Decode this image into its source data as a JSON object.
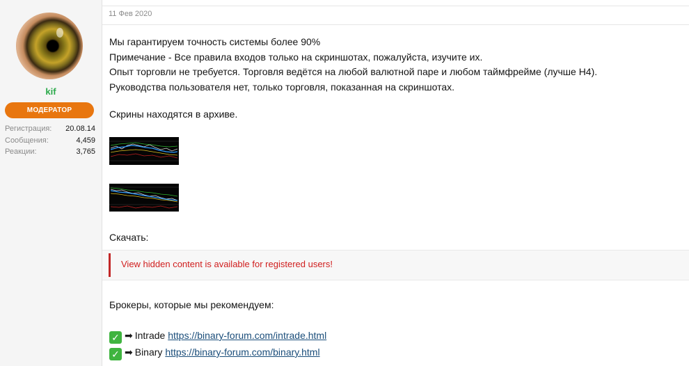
{
  "user": {
    "name": "kif",
    "role": "МОДЕРАТОР",
    "stats": [
      {
        "label": "Регистрация:",
        "value": "20.08.14"
      },
      {
        "label": "Сообщения:",
        "value": "4,459"
      },
      {
        "label": "Реакции:",
        "value": "3,765"
      }
    ]
  },
  "post": {
    "date": "11 Фев 2020",
    "lines": [
      "Мы гарантируем точность системы более 90%",
      "Примечание - Все правила входов только на скриншотах, пожалуйста, изучите их.",
      "Опыт торговли не требуется. Торговля ведётся на любой валютной паре и любом таймфрейме (лучше H4).",
      "Руководства пользователя нет, только торговля, показанная на скриншотах."
    ],
    "archive_text": "Скрины находятся в архиве.",
    "download_label": "Скачать:",
    "hidden_content_text": "View hidden content is available for registered users!",
    "brokers_heading": "Брокеры, которые мы рекомендуем:",
    "brokers": [
      {
        "name": "Intrade",
        "url": "https://binary-forum.com/intrade.html"
      },
      {
        "name": "Binary",
        "url": "https://binary-forum.com/binary.html"
      }
    ]
  },
  "colors": {
    "accent_badge": "#e8760f",
    "username": "#2aa94a",
    "hidden_text": "#d01e1e",
    "link": "#1a4d7a"
  },
  "icons": [
    "check-mark-icon",
    "right-arrow-icon"
  ]
}
